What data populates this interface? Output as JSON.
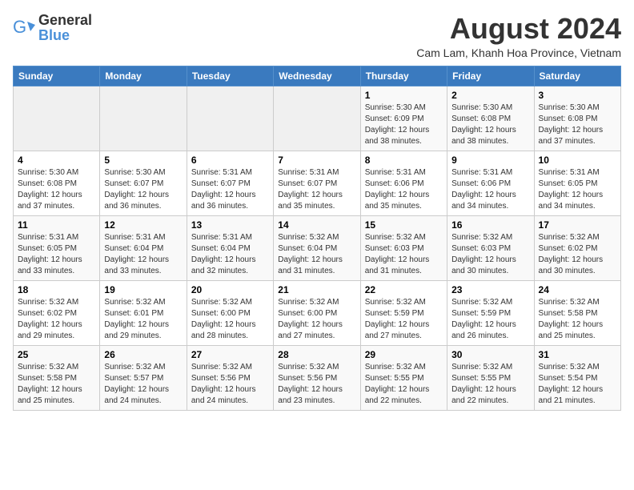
{
  "logo": {
    "general": "General",
    "blue": "Blue"
  },
  "header": {
    "title": "August 2024",
    "subtitle": "Cam Lam, Khanh Hoa Province, Vietnam"
  },
  "days_of_week": [
    "Sunday",
    "Monday",
    "Tuesday",
    "Wednesday",
    "Thursday",
    "Friday",
    "Saturday"
  ],
  "weeks": [
    [
      {
        "day": "",
        "info": ""
      },
      {
        "day": "",
        "info": ""
      },
      {
        "day": "",
        "info": ""
      },
      {
        "day": "",
        "info": ""
      },
      {
        "day": "1",
        "info": "Sunrise: 5:30 AM\nSunset: 6:09 PM\nDaylight: 12 hours\nand 38 minutes."
      },
      {
        "day": "2",
        "info": "Sunrise: 5:30 AM\nSunset: 6:08 PM\nDaylight: 12 hours\nand 38 minutes."
      },
      {
        "day": "3",
        "info": "Sunrise: 5:30 AM\nSunset: 6:08 PM\nDaylight: 12 hours\nand 37 minutes."
      }
    ],
    [
      {
        "day": "4",
        "info": "Sunrise: 5:30 AM\nSunset: 6:08 PM\nDaylight: 12 hours\nand 37 minutes."
      },
      {
        "day": "5",
        "info": "Sunrise: 5:30 AM\nSunset: 6:07 PM\nDaylight: 12 hours\nand 36 minutes."
      },
      {
        "day": "6",
        "info": "Sunrise: 5:31 AM\nSunset: 6:07 PM\nDaylight: 12 hours\nand 36 minutes."
      },
      {
        "day": "7",
        "info": "Sunrise: 5:31 AM\nSunset: 6:07 PM\nDaylight: 12 hours\nand 35 minutes."
      },
      {
        "day": "8",
        "info": "Sunrise: 5:31 AM\nSunset: 6:06 PM\nDaylight: 12 hours\nand 35 minutes."
      },
      {
        "day": "9",
        "info": "Sunrise: 5:31 AM\nSunset: 6:06 PM\nDaylight: 12 hours\nand 34 minutes."
      },
      {
        "day": "10",
        "info": "Sunrise: 5:31 AM\nSunset: 6:05 PM\nDaylight: 12 hours\nand 34 minutes."
      }
    ],
    [
      {
        "day": "11",
        "info": "Sunrise: 5:31 AM\nSunset: 6:05 PM\nDaylight: 12 hours\nand 33 minutes."
      },
      {
        "day": "12",
        "info": "Sunrise: 5:31 AM\nSunset: 6:04 PM\nDaylight: 12 hours\nand 33 minutes."
      },
      {
        "day": "13",
        "info": "Sunrise: 5:31 AM\nSunset: 6:04 PM\nDaylight: 12 hours\nand 32 minutes."
      },
      {
        "day": "14",
        "info": "Sunrise: 5:32 AM\nSunset: 6:04 PM\nDaylight: 12 hours\nand 31 minutes."
      },
      {
        "day": "15",
        "info": "Sunrise: 5:32 AM\nSunset: 6:03 PM\nDaylight: 12 hours\nand 31 minutes."
      },
      {
        "day": "16",
        "info": "Sunrise: 5:32 AM\nSunset: 6:03 PM\nDaylight: 12 hours\nand 30 minutes."
      },
      {
        "day": "17",
        "info": "Sunrise: 5:32 AM\nSunset: 6:02 PM\nDaylight: 12 hours\nand 30 minutes."
      }
    ],
    [
      {
        "day": "18",
        "info": "Sunrise: 5:32 AM\nSunset: 6:02 PM\nDaylight: 12 hours\nand 29 minutes."
      },
      {
        "day": "19",
        "info": "Sunrise: 5:32 AM\nSunset: 6:01 PM\nDaylight: 12 hours\nand 29 minutes."
      },
      {
        "day": "20",
        "info": "Sunrise: 5:32 AM\nSunset: 6:00 PM\nDaylight: 12 hours\nand 28 minutes."
      },
      {
        "day": "21",
        "info": "Sunrise: 5:32 AM\nSunset: 6:00 PM\nDaylight: 12 hours\nand 27 minutes."
      },
      {
        "day": "22",
        "info": "Sunrise: 5:32 AM\nSunset: 5:59 PM\nDaylight: 12 hours\nand 27 minutes."
      },
      {
        "day": "23",
        "info": "Sunrise: 5:32 AM\nSunset: 5:59 PM\nDaylight: 12 hours\nand 26 minutes."
      },
      {
        "day": "24",
        "info": "Sunrise: 5:32 AM\nSunset: 5:58 PM\nDaylight: 12 hours\nand 25 minutes."
      }
    ],
    [
      {
        "day": "25",
        "info": "Sunrise: 5:32 AM\nSunset: 5:58 PM\nDaylight: 12 hours\nand 25 minutes."
      },
      {
        "day": "26",
        "info": "Sunrise: 5:32 AM\nSunset: 5:57 PM\nDaylight: 12 hours\nand 24 minutes."
      },
      {
        "day": "27",
        "info": "Sunrise: 5:32 AM\nSunset: 5:56 PM\nDaylight: 12 hours\nand 24 minutes."
      },
      {
        "day": "28",
        "info": "Sunrise: 5:32 AM\nSunset: 5:56 PM\nDaylight: 12 hours\nand 23 minutes."
      },
      {
        "day": "29",
        "info": "Sunrise: 5:32 AM\nSunset: 5:55 PM\nDaylight: 12 hours\nand 22 minutes."
      },
      {
        "day": "30",
        "info": "Sunrise: 5:32 AM\nSunset: 5:55 PM\nDaylight: 12 hours\nand 22 minutes."
      },
      {
        "day": "31",
        "info": "Sunrise: 5:32 AM\nSunset: 5:54 PM\nDaylight: 12 hours\nand 21 minutes."
      }
    ]
  ]
}
